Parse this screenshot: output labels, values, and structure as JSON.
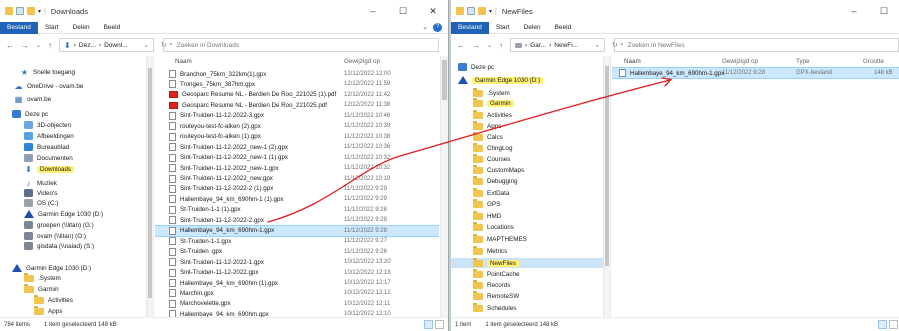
{
  "left": {
    "title": "Downloads",
    "ribbon": {
      "file": "Bestand",
      "start": "Start",
      "share": "Delen",
      "view": "Beeld"
    },
    "address": {
      "crumb1": "Dez...",
      "crumb2": "Downl...",
      "search_placeholder": "Zoeken in Downloads"
    },
    "columns": {
      "name": "Naam",
      "date": "Gewijzigd op"
    },
    "nav": [
      {
        "label": "Snelle toegang",
        "icon": "star-icon"
      },
      {
        "label": "OneDrive - ovam.be",
        "icon": "cloud-icon"
      },
      {
        "label": "ovam.be",
        "icon": "building-icon"
      },
      {
        "label": "Deze pc",
        "icon": "computer-icon"
      },
      {
        "label": "3D-objecten",
        "icon": "cube-icon"
      },
      {
        "label": "Afbeeldingen",
        "icon": "pictures-icon"
      },
      {
        "label": "Bureaublad",
        "icon": "desktop-icon"
      },
      {
        "label": "Documenten",
        "icon": "documents-icon"
      },
      {
        "label": "Downloads",
        "icon": "download-icon"
      },
      {
        "label": "Muziek",
        "icon": "music-icon"
      },
      {
        "label": "Video's",
        "icon": "video-icon"
      },
      {
        "label": "OS (C:)",
        "icon": "drive-icon"
      },
      {
        "label": "Garmin Edge 1030 (D:)",
        "icon": "garmin-icon"
      },
      {
        "label": "groepen (\\\\litan) (G:)",
        "icon": "network-drive-icon"
      },
      {
        "label": "ovam (\\\\litan) (O:)",
        "icon": "network-drive-icon"
      },
      {
        "label": "gisdata (\\\\naiad) (S:)",
        "icon": "network-drive-icon"
      },
      {
        "label": "Garmin Edge 1030 (D:)",
        "icon": "garmin-icon"
      },
      {
        "label": ".System",
        "icon": "folder-icon"
      },
      {
        "label": "Garmin",
        "icon": "folder-icon"
      },
      {
        "label": "Activities",
        "icon": "folder-icon"
      },
      {
        "label": "Apps",
        "icon": "folder-icon"
      }
    ],
    "files": [
      {
        "name": "Branchon_75km_322km(1).gpx",
        "date": "12/12/2022 12:00",
        "type": "gpx"
      },
      {
        "name": "Tronges_75km_387hm.gpx",
        "date": "12/12/2022 11:59",
        "type": "gpx"
      },
      {
        "name": "Geosparc Resume NL - Berdien De Roo_221025 (1).pdf",
        "date": "12/12/2022 11:42",
        "type": "pdf"
      },
      {
        "name": "Geosparc Resume NL - Berdien De Roo_221025.pdf",
        "date": "12/12/2022 11:38",
        "type": "pdf"
      },
      {
        "name": "Sint-Truiden-11-12-2022-3.gpx",
        "date": "11/12/2022 10:46",
        "type": "gpx"
      },
      {
        "name": "routeyou-test-fc-alken (2).gpx",
        "date": "11/12/2022 10:39",
        "type": "gpx"
      },
      {
        "name": "routeyou-test-fc-alken (1).gpx",
        "date": "11/12/2022 10:38",
        "type": "gpx"
      },
      {
        "name": "Sint-Truiden-11-12-2022_new-1 (2).gpx",
        "date": "11/12/2022 10:36",
        "type": "gpx"
      },
      {
        "name": "Sint-Truiden-11-12-2022_new-1 (1).gpx",
        "date": "11/12/2022 10:32",
        "type": "gpx"
      },
      {
        "name": "Sint-Truiden-11-12-2022_new-1.gpx",
        "date": "11/12/2022 10:32",
        "type": "gpx"
      },
      {
        "name": "Sint-Truiden-11-12-2022_new.gpx",
        "date": "11/12/2022 10:19",
        "type": "gpx"
      },
      {
        "name": "Sint-Truiden-11-12-2022-2 (1).gpx",
        "date": "11/12/2022 9:29",
        "type": "gpx"
      },
      {
        "name": "Hallembaye_94_km_690hm-1 (1).gpx",
        "date": "11/12/2022 9:29",
        "type": "gpx"
      },
      {
        "name": "St-Truiden-1-1 (1).gpx",
        "date": "11/12/2022 9:28",
        "type": "gpx"
      },
      {
        "name": "Sint-Truiden-11-12-2022-2.gpx",
        "date": "11/12/2022 9:28",
        "type": "gpx"
      },
      {
        "name": "Hallembaye_94_km_690hm-1.gpx",
        "date": "11/12/2022 9:28",
        "type": "gpx",
        "selected": true
      },
      {
        "name": "St-Truiden-1-1.gpx",
        "date": "11/12/2022 9:27",
        "type": "gpx"
      },
      {
        "name": "St-Truiden .gpx",
        "date": "11/12/2022 9:26",
        "type": "gpx"
      },
      {
        "name": "Sint-Truiden-11-12-2022-1.gpx",
        "date": "10/12/2022 13:20",
        "type": "gpx"
      },
      {
        "name": "Sint-Truiden-11-12-2022.gpx",
        "date": "10/12/2022 12:18",
        "type": "gpx"
      },
      {
        "name": "Hallembaye_94_km_690hm (1).gpx",
        "date": "10/12/2022 12:17",
        "type": "gpx"
      },
      {
        "name": "Marchin.gpx",
        "date": "10/12/2022 12:12",
        "type": "gpx"
      },
      {
        "name": "Marchovelette.gpx",
        "date": "10/12/2022 12:11",
        "type": "gpx"
      },
      {
        "name": "Hallembaye_94_km_690hm.gpx",
        "date": "10/12/2022 12:10",
        "type": "gpx"
      }
    ],
    "status": {
      "count": "784 items",
      "selection": "1 item geselecteerd 148 kB"
    }
  },
  "right": {
    "title": "NewFiles",
    "ribbon": {
      "file": "Bestand",
      "start": "Start",
      "share": "Delen",
      "view": "Beeld"
    },
    "address": {
      "crumb1": "Gar...",
      "crumb2": "NewFi...",
      "search_placeholder": "Zoeken in NewFiles"
    },
    "columns": {
      "name": "Naam",
      "date": "Gewijzigd op",
      "type": "Type",
      "size": "Grootte"
    },
    "nav": [
      {
        "label": "Deze pc",
        "icon": "computer-icon"
      },
      {
        "label": "Garmin Edge 1030 (D:)",
        "icon": "garmin-icon"
      },
      {
        "label": ".System",
        "icon": "folder-icon"
      },
      {
        "label": "Garmin",
        "icon": "folder-icon"
      },
      {
        "label": "Activities",
        "icon": "folder-icon"
      },
      {
        "label": "Apps",
        "icon": "folder-icon"
      },
      {
        "label": "Calcs",
        "icon": "folder-icon"
      },
      {
        "label": "ChngLog",
        "icon": "folder-icon"
      },
      {
        "label": "Courses",
        "icon": "folder-icon"
      },
      {
        "label": "CustomMaps",
        "icon": "folder-icon"
      },
      {
        "label": "Debugging",
        "icon": "folder-icon"
      },
      {
        "label": "ExtData",
        "icon": "folder-icon"
      },
      {
        "label": "GPS",
        "icon": "folder-icon"
      },
      {
        "label": "HMD",
        "icon": "folder-icon"
      },
      {
        "label": "Locations",
        "icon": "folder-icon"
      },
      {
        "label": "MAPTHEMES",
        "icon": "folder-icon"
      },
      {
        "label": "Metrics",
        "icon": "folder-icon"
      },
      {
        "label": "NewFiles",
        "icon": "folder-icon"
      },
      {
        "label": "PointCache",
        "icon": "folder-icon"
      },
      {
        "label": "Records",
        "icon": "folder-icon"
      },
      {
        "label": "RemoteSW",
        "icon": "folder-icon"
      },
      {
        "label": "Schedules",
        "icon": "folder-icon"
      }
    ],
    "files": [
      {
        "name": "Hallembaye_94_km_690hm-1.gpx",
        "date": "11/12/2022 9:28",
        "type": "GPX-bestand",
        "size": "148 kB"
      }
    ],
    "status": {
      "count": "1 item",
      "selection": "1 item geselecteerd 148 kB"
    }
  },
  "colors": {
    "accent": "#1e63b5",
    "highlight": "#fff176",
    "selection": "#cce8ff",
    "annotation": "#e11d1d"
  }
}
